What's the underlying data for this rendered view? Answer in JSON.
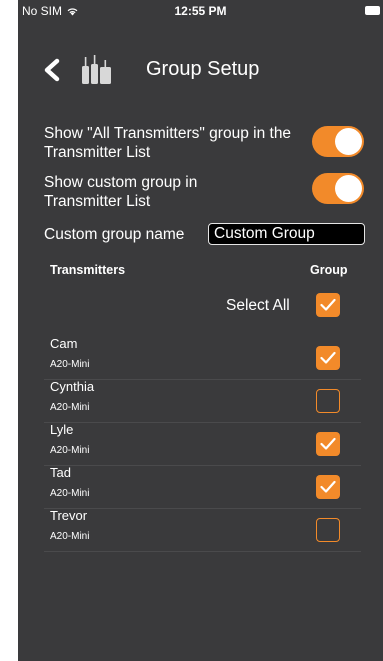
{
  "status_bar": {
    "carrier": "No SIM",
    "time": "12:55 PM"
  },
  "nav": {
    "title": "Group Setup",
    "back_icon": "chevron-left-icon",
    "logo_icon": "transmitters-logo-icon"
  },
  "settings": {
    "show_all_label": "Show \"All Transmitters\" group in the Transmitter List",
    "show_all_enabled": true,
    "show_custom_label": "Show custom group in Transmitter List",
    "show_custom_enabled": true,
    "custom_name_label": "Custom group name",
    "custom_name_value": "Custom Group"
  },
  "list": {
    "col_transmitters": "Transmitters",
    "col_group": "Group",
    "select_all_label": "Select All",
    "select_all_checked": true,
    "items": [
      {
        "name": "Cam",
        "model": "A20-Mini",
        "checked": true
      },
      {
        "name": "Cynthia",
        "model": "A20-Mini",
        "checked": false
      },
      {
        "name": "Lyle",
        "model": "A20-Mini",
        "checked": true
      },
      {
        "name": "Tad",
        "model": "A20-Mini",
        "checked": true
      },
      {
        "name": "Trevor",
        "model": "A20-Mini",
        "checked": false
      }
    ]
  },
  "colors": {
    "background": "#3a3a3c",
    "accent": "#f28a2a"
  }
}
